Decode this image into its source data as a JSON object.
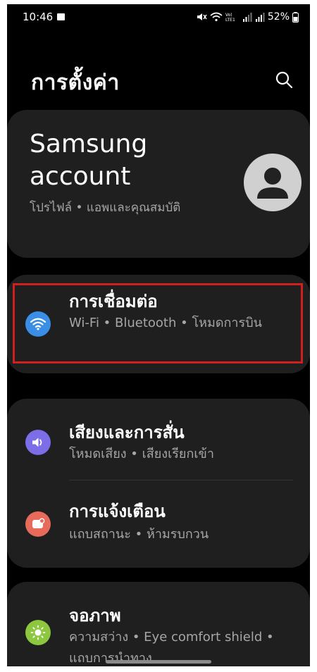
{
  "status_bar": {
    "time": "10:46",
    "network_label": "VoLTE1",
    "battery": "52%"
  },
  "header": {
    "title": "การตั้งค่า",
    "search_icon": "search-icon"
  },
  "account": {
    "name": "Samsung account",
    "subtitle": "โปรไฟล์ • แอพและคุณสมบัติ",
    "avatar_icon": "person-icon"
  },
  "items": [
    {
      "title": "การเชื่อมต่อ",
      "subtitle": "Wi-Fi • Bluetooth • โหมดการบิน",
      "icon": "wifi-icon",
      "color": "#3a8ee6"
    },
    {
      "title": "เสียงและการสั่น",
      "subtitle": "โหมดเสียง • เสียงเรียกเข้า",
      "icon": "volume-icon",
      "color": "#7b6ee6"
    },
    {
      "title": "การแจ้งเตือน",
      "subtitle": "แถบสถานะ • ห้ามรบกวน",
      "icon": "notification-icon",
      "color": "#e86a5a"
    },
    {
      "title": "จอภาพ",
      "subtitle": "ความสว่าง • Eye comfort shield • แถบการนำทาง",
      "icon": "brightness-icon",
      "color": "#8dc63f"
    }
  ],
  "colors": {
    "background": "#000000",
    "card": "#1f1f1f",
    "highlight": "#d01f1f"
  }
}
